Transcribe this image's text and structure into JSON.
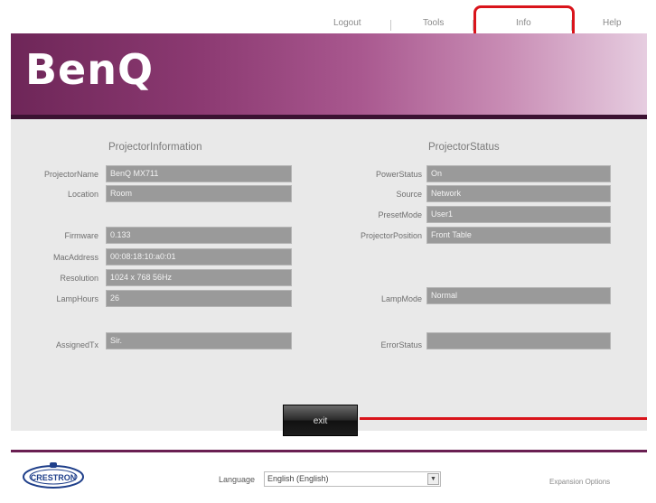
{
  "nav": {
    "logout": "Logout",
    "tools": "Tools",
    "info": "Info",
    "help": "Help"
  },
  "brand": {
    "logo": "BenQ"
  },
  "info": {
    "title": "ProjectorInformation",
    "labels": {
      "name": "ProjectorName",
      "location": "Location",
      "firmware": "Firmware",
      "mac": "MacAddress",
      "resolution": "Resolution",
      "lamp_hours": "LampHours",
      "assigned": "AssignedTx"
    },
    "values": {
      "name": "BenQ MX711",
      "location": "Room",
      "firmware": "0.133",
      "mac": "00:08:18:10:a0:01",
      "resolution": "1024 x 768 56Hz",
      "lamp_hours": "26",
      "assigned": "Sir."
    }
  },
  "status": {
    "title": "ProjectorStatus",
    "labels": {
      "power": "PowerStatus",
      "source": "Source",
      "preset": "PresetMode",
      "position": "ProjectorPosition",
      "lamp_mode": "LampMode",
      "error": "ErrorStatus"
    },
    "values": {
      "power": "On",
      "source": "Network",
      "preset": "User1",
      "position": "Front Table",
      "lamp_mode": "Normal",
      "error": ""
    }
  },
  "exit_label": "exit",
  "footer": {
    "crestron": "CRESTRON",
    "language_label": "Language",
    "language_value": "English (English)",
    "expansion": "Expansion Options"
  },
  "colors": {
    "accent": "#6e2658",
    "highlight": "#d9141b"
  }
}
